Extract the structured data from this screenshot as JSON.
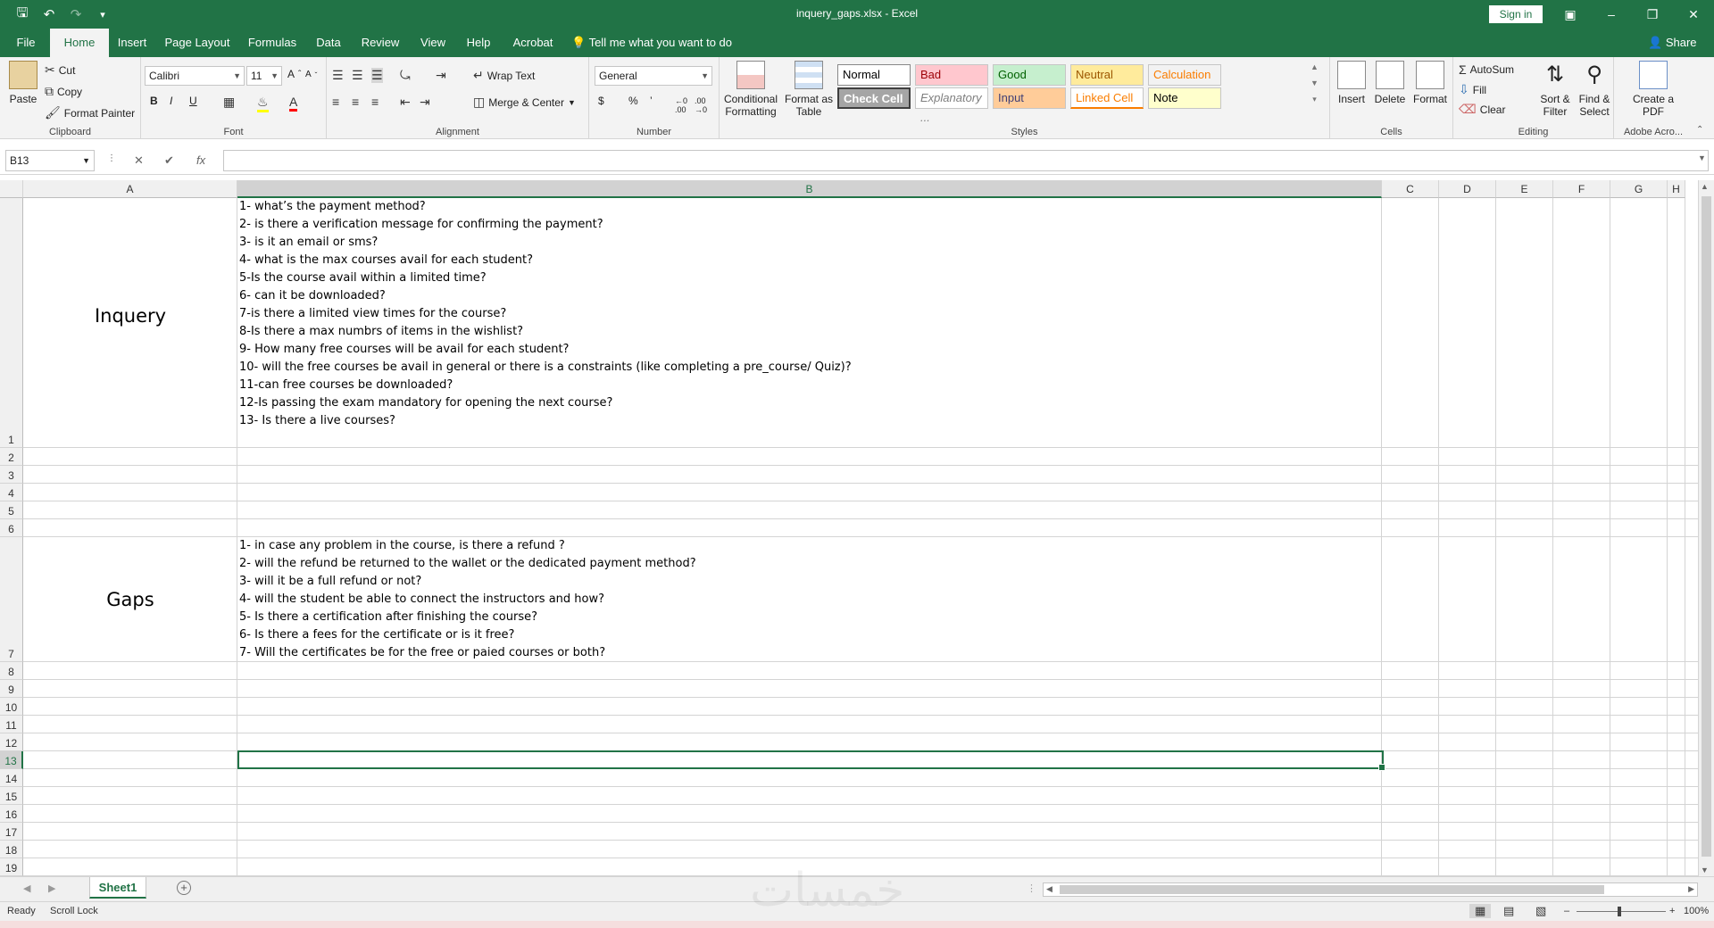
{
  "window": {
    "title": "inquery_gaps.xlsx  -  Excel",
    "sign_in": "Sign in",
    "qat": {
      "save_icon": "save-icon",
      "undo_icon": "undo-icon",
      "redo_icon": "redo-icon",
      "customize_icon": "customize-icon"
    }
  },
  "tabs": [
    "File",
    "Home",
    "Insert",
    "Page Layout",
    "Formulas",
    "Data",
    "Review",
    "View",
    "Help",
    "Acrobat"
  ],
  "active_tab": "Home",
  "tell_me": "Tell me what you want to do",
  "share": "Share",
  "ribbon": {
    "clipboard": {
      "label": "Clipboard",
      "paste": "Paste",
      "cut": "Cut",
      "copy": "Copy",
      "format_painter": "Format Painter"
    },
    "font": {
      "label": "Font",
      "name": "Calibri",
      "size": "11",
      "bold": "B",
      "italic": "I",
      "underline": "U"
    },
    "alignment": {
      "label": "Alignment",
      "wrap_text": "Wrap Text",
      "merge_center": "Merge & Center"
    },
    "number": {
      "label": "Number",
      "format": "General",
      "currency": "$",
      "percent": "%",
      "comma": "’"
    },
    "styles": {
      "label": "Styles",
      "conditional_formatting": "Conditional Formatting",
      "format_as_table": "Format as Table",
      "cells": [
        {
          "name": "Normal",
          "bg": "#ffffff",
          "fg": "#000000"
        },
        {
          "name": "Bad",
          "bg": "#ffc7ce",
          "fg": "#9c0006"
        },
        {
          "name": "Good",
          "bg": "#c6efce",
          "fg": "#006100"
        },
        {
          "name": "Neutral",
          "bg": "#ffeb9c",
          "fg": "#9c5700"
        },
        {
          "name": "Calculation",
          "bg": "#f2f2f2",
          "fg": "#fa7d00"
        },
        {
          "name": "Check Cell",
          "bg": "#a5a5a5",
          "fg": "#ffffff"
        },
        {
          "name": "Explanatory ...",
          "bg": "#ffffff",
          "fg": "#7f7f7f"
        },
        {
          "name": "Input",
          "bg": "#ffcc99",
          "fg": "#3f3f76"
        },
        {
          "name": "Linked Cell",
          "bg": "#ffffff",
          "fg": "#fa7d00"
        },
        {
          "name": "Note",
          "bg": "#ffffcc",
          "fg": "#000000"
        }
      ]
    },
    "cells": {
      "label": "Cells",
      "insert": "Insert",
      "delete": "Delete",
      "format": "Format"
    },
    "editing": {
      "label": "Editing",
      "autosum": "AutoSum",
      "fill": "Fill",
      "clear": "Clear",
      "sort_filter": "Sort & Filter",
      "find_select": "Find & Select"
    },
    "adobe": {
      "label": "Adobe Acro...",
      "create_pdf": "Create a PDF"
    }
  },
  "formula_bar": {
    "name_box": "B13",
    "cancel": "✕",
    "enter": "✔",
    "fx": "fx",
    "value": ""
  },
  "columns": [
    "A",
    "B",
    "C",
    "D",
    "E",
    "F",
    "G",
    "H"
  ],
  "selected_column": "B",
  "rows": [
    "1",
    "2",
    "3",
    "4",
    "5",
    "6",
    "7",
    "8",
    "9",
    "10",
    "11",
    "12",
    "13",
    "14",
    "15",
    "16",
    "17",
    "18",
    "19"
  ],
  "selected_row": "13",
  "cells": {
    "A1": "Inquery",
    "B1": [
      "1- what’s the payment method?",
      "2- is there a verification message for confirming the payment?",
      "3- is it an email or sms?",
      "4- what is the max courses avail for each student?",
      "5-Is the course avail within a limited time?",
      "6- can it be downloaded?",
      "7-is there a limited view times for the course?",
      "8-Is there a max numbrs of items in the wishlist?",
      "9- How many free courses will be avail for each student?",
      "10- will the free courses be avail in general or there is a constraints (like completing a pre_course/ Quiz)?",
      "11-can free courses be downloaded?",
      "12-Is passing the exam mandatory for opening the next course?",
      "13- Is there a live courses?"
    ],
    "A7": "Gaps",
    "B7": [
      "1- in case any problem in the course, is there a refund ?",
      "2- will the refund be returned to the wallet or the dedicated payment method?",
      "3- will it be a full refund or not?",
      "4- will the student be able to connect the instructors and how?",
      "5- Is there a certification after finishing the course?",
      "6- Is there a fees for the certificate or is it free?",
      "7- Will the certificates be for the free or paied courses or both?"
    ]
  },
  "sheets": [
    "Sheet1"
  ],
  "status": {
    "ready": "Ready",
    "scroll_lock": "Scroll Lock",
    "zoom": "100%"
  },
  "watermark": "خمسات"
}
